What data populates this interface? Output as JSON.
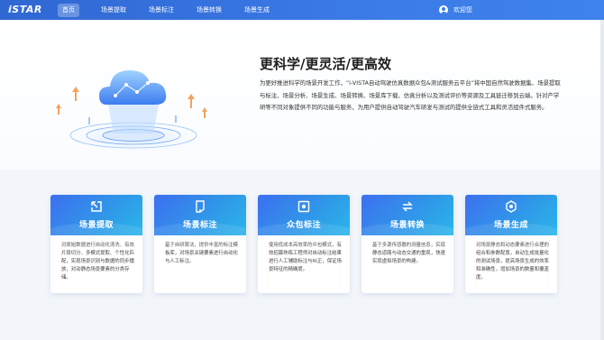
{
  "brand": {
    "logo_text": "iSTAR"
  },
  "nav": {
    "items": [
      {
        "label": "首页",
        "active": true
      },
      {
        "label": "场景提取",
        "active": false
      },
      {
        "label": "场景标注",
        "active": false
      },
      {
        "label": "场景转换",
        "active": false
      },
      {
        "label": "场景生成",
        "active": false
      }
    ]
  },
  "user": {
    "greeting": "欢迎您",
    "icon": "user-avatar-icon"
  },
  "hero": {
    "title": "更科学/更灵活/更高效",
    "description": "为更好推进科学的场景开发工作，“i-VISTA自动驾驶仿真数据众包&测试服务云平台”将中国自然驾驶数据集、场景提取与标注、场景分析、场景生成、场景转换、场景库下载、仿真分析以及测试评价等资源及工具链迁移到云端。针对产学研等不同对象提供不同的功能与服务，为用户提供自动驾驶汽车研发与测试的提供全链式工具和灵活组件式服务。"
  },
  "cards": [
    {
      "title": "场景提取",
      "icon": "extract-icon",
      "description": "对原始数据进行自动化清洗、有效片段切分、多模式提取、个性化匹配，实现场景识别与数据的同步播放，对动静态场景要素的分类存储。"
    },
    {
      "title": "场景标注",
      "icon": "annotate-icon",
      "description": "基于自研算法，提供丰富的标注模板库，对场景关键要素进行自动化与人工标注。"
    },
    {
      "title": "众包标注",
      "icon": "crowdsource-icon",
      "description": "使用低成本高效率的众包模式，有效招募熟练工程师对自动标注结果进行人工辅助标注与纠正，保证场景特征的精确度。"
    },
    {
      "title": "场景转换",
      "icon": "convert-icon",
      "description": "基于多源传感器的测量信息，实现静态道路与动态交通的重现，快速实现虚拟场景的构建。"
    },
    {
      "title": "场景生成",
      "icon": "generate-icon",
      "description": "对场景静态和动态要素进行合理的组合和参数配置，自动生成批量化的测试场景，提高场景生成的效率和准确性，增加场景的数量和覆盖度。"
    }
  ],
  "colors": {
    "nav_bg": "#3b7be6",
    "card_accent": "#2f9ae8"
  }
}
